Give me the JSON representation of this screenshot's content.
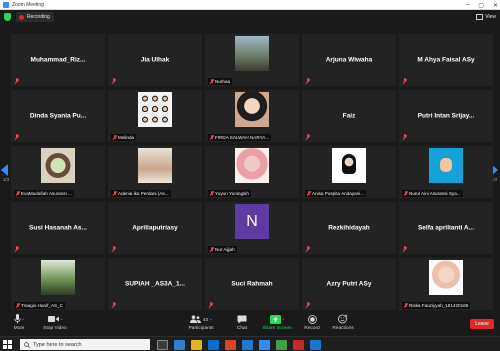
{
  "window": {
    "title": "Zoom Meeting"
  },
  "meeting": {
    "recording_label": "Recording",
    "view_label": "View"
  },
  "tiles": [
    {
      "name": "Muhammad_Riz...",
      "style": "center"
    },
    {
      "name": "Jia Ulhak",
      "style": "center"
    },
    {
      "name": "Nurhaa",
      "style": "photo",
      "photo": "nurhaa"
    },
    {
      "name": "Arjuna Wiwaha",
      "style": "center"
    },
    {
      "name": "M Ahya Faisal ASy",
      "style": "center"
    },
    {
      "name": "Dinda Syania Pu...",
      "style": "center"
    },
    {
      "name": "Melinda",
      "style": "photo",
      "photo": "melinda"
    },
    {
      "name": "FIRDA SALWAH NARYA...",
      "style": "photo",
      "photo": "firda"
    },
    {
      "name": "Faiz",
      "style": "center"
    },
    {
      "name": "Putri Intan Srijay...",
      "style": "center"
    },
    {
      "name": "EvaMudafiah Asuransi ...",
      "style": "photo",
      "photo": "eva"
    },
    {
      "name": "Adenia ika Perdani (As...",
      "style": "photo",
      "photo": "adenia"
    },
    {
      "name": "Yuyun Yuningsih",
      "style": "photo",
      "photo": "yuyun"
    },
    {
      "name": "Anisa Puspita Andayani...",
      "style": "photo",
      "photo": "anisa"
    },
    {
      "name": "Nurul Aini Asuransi Sya...",
      "style": "photo",
      "photo": "nurul"
    },
    {
      "name": "Susi Hasanah As...",
      "style": "center"
    },
    {
      "name": "Apriliaputriasy",
      "style": "center"
    },
    {
      "name": "Nur Aijjah",
      "style": "photo",
      "photo": "nuraijjah",
      "initial": "N"
    },
    {
      "name": "Rezkihidayah",
      "style": "center"
    },
    {
      "name": "Selfa aprilianti A...",
      "style": "center"
    },
    {
      "name": "Traagio Hanif_AS_C",
      "style": "photo",
      "photo": "traagio"
    },
    {
      "name": "SUPIAH _AS3A_1...",
      "style": "center"
    },
    {
      "name": "Suci Rahmah",
      "style": "center"
    },
    {
      "name": "Azry Putri ASy",
      "style": "center"
    },
    {
      "name": "Riska Fauziyyah_181420165",
      "style": "photo",
      "photo": "riska"
    }
  ],
  "pager": {
    "left": "1/3",
    "right": "1/3"
  },
  "toolbar": {
    "mute": "Mute",
    "stop_video": "Stop Video",
    "participants": "Participants",
    "participants_count": "43",
    "chat": "Chat",
    "share_screen": "Share Screen",
    "record": "Record",
    "reactions": "Reactions",
    "leave": "Leave"
  },
  "taskbar": {
    "search_placeholder": "Type here to search"
  },
  "colors": {
    "accent": "#2d8cff",
    "share": "#23d959",
    "leave": "#e02828",
    "tile": "#232323"
  }
}
